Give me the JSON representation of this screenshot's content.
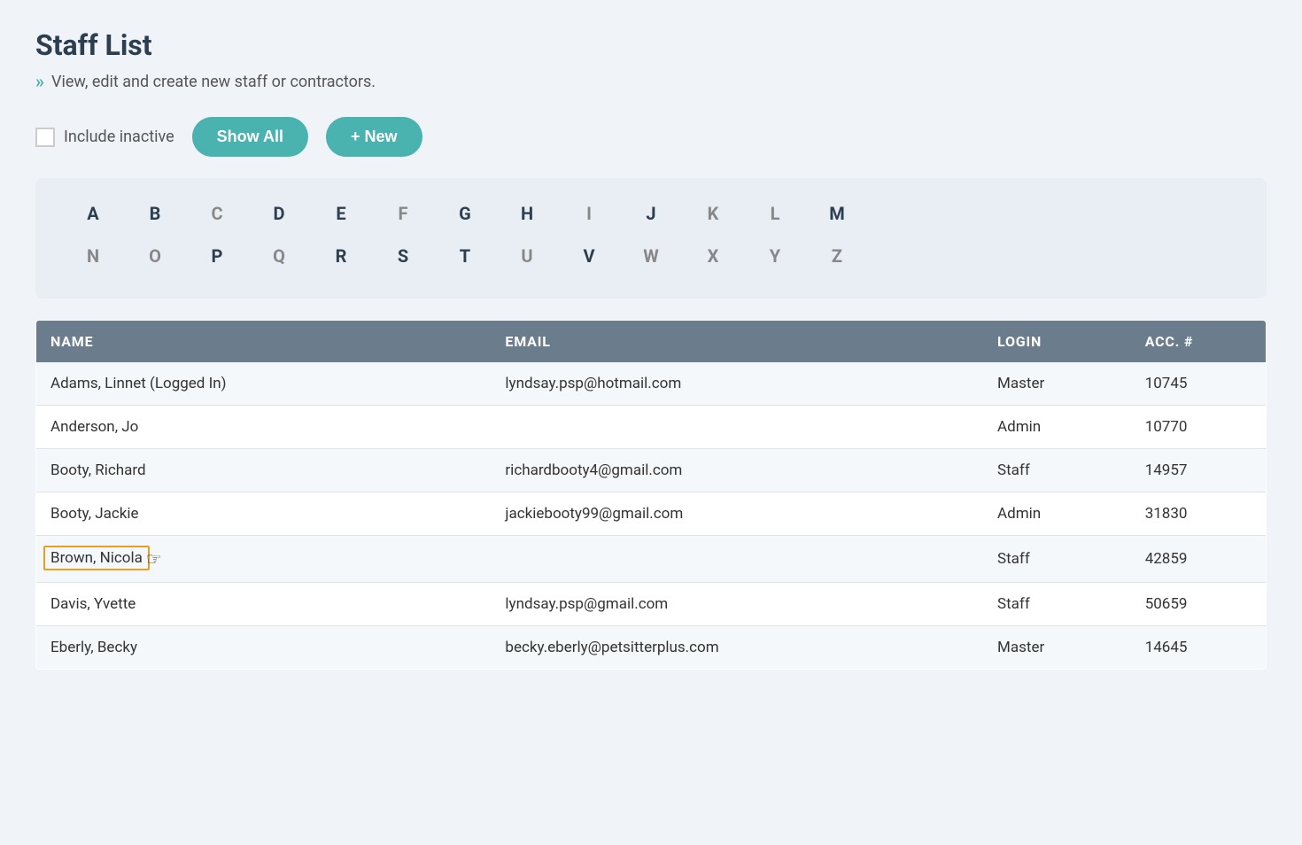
{
  "page": {
    "title": "Staff List",
    "subtitle": "View, edit and create new staff or contractors."
  },
  "controls": {
    "include_inactive_label": "Include inactive",
    "show_all_label": "Show All",
    "new_label": "+ New"
  },
  "alphabet": {
    "row1": [
      "A",
      "B",
      "C",
      "D",
      "E",
      "F",
      "G",
      "H",
      "I",
      "J",
      "K",
      "L",
      "M"
    ],
    "row2": [
      "N",
      "O",
      "P",
      "Q",
      "R",
      "S",
      "T",
      "U",
      "V",
      "W",
      "X",
      "Y",
      "Z"
    ],
    "active": [
      "A",
      "B",
      "D",
      "E",
      "G",
      "H",
      "J",
      "M",
      "P",
      "R",
      "S",
      "T",
      "V"
    ]
  },
  "table": {
    "headers": {
      "name": "NAME",
      "email": "EMAIL",
      "login": "LOGIN",
      "acc": "ACC. #"
    },
    "rows": [
      {
        "name": "Adams, Linnet (Logged In)",
        "email": "lyndsay.psp@hotmail.com",
        "login": "Master",
        "acc": "10745",
        "highlighted": false
      },
      {
        "name": "Anderson, Jo",
        "email": "",
        "login": "Admin",
        "acc": "10770",
        "highlighted": false
      },
      {
        "name": "Booty, Richard",
        "email": "richardbooty4@gmail.com",
        "login": "Staff",
        "acc": "14957",
        "highlighted": false
      },
      {
        "name": "Booty, Jackie",
        "email": "jackiebooty99@gmail.com",
        "login": "Admin",
        "acc": "31830",
        "highlighted": false
      },
      {
        "name": "Brown, Nicola",
        "email": "",
        "login": "Staff",
        "acc": "42859",
        "highlighted": true
      },
      {
        "name": "Davis, Yvette",
        "email": "lyndsay.psp@gmail.com",
        "login": "Staff",
        "acc": "50659",
        "highlighted": false
      },
      {
        "name": "Eberly, Becky",
        "email": "becky.eberly@petsitterplus.com",
        "login": "Master",
        "acc": "14645",
        "highlighted": false
      }
    ]
  }
}
